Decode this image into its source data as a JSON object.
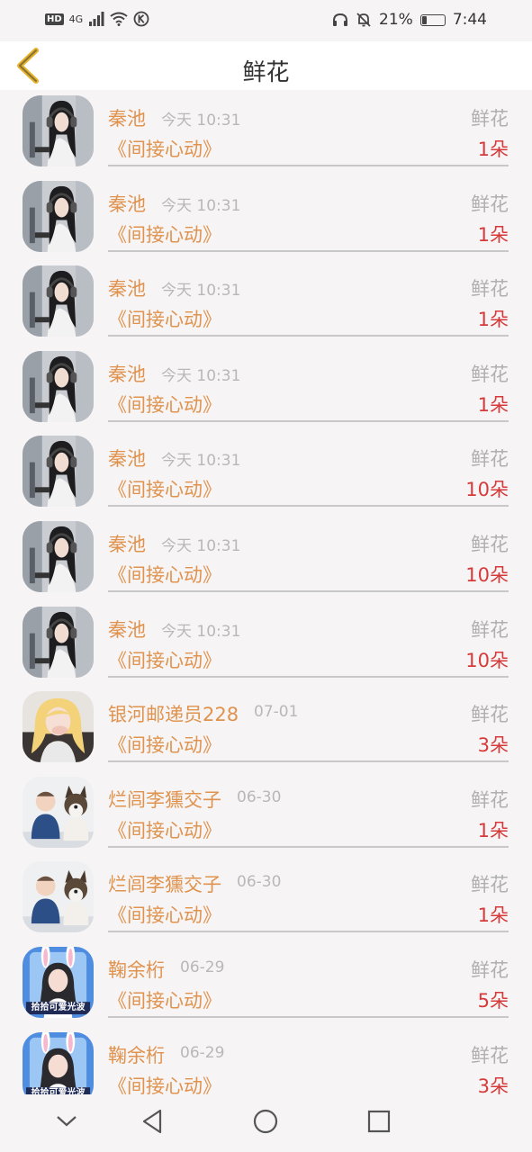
{
  "status_bar": {
    "network_badge": "HD",
    "signal_text": "4G",
    "battery_percent": "21%",
    "battery_level": 0.21,
    "time": "7:44"
  },
  "header": {
    "title": "鲜花"
  },
  "rows": [
    {
      "name": "秦池",
      "time": "今天 10:31",
      "gift": "鲜花",
      "song": "《间接心动》",
      "count": "1朵",
      "avatar": "girl-headphones"
    },
    {
      "name": "秦池",
      "time": "今天 10:31",
      "gift": "鲜花",
      "song": "《间接心动》",
      "count": "1朵",
      "avatar": "girl-headphones"
    },
    {
      "name": "秦池",
      "time": "今天 10:31",
      "gift": "鲜花",
      "song": "《间接心动》",
      "count": "1朵",
      "avatar": "girl-headphones"
    },
    {
      "name": "秦池",
      "time": "今天 10:31",
      "gift": "鲜花",
      "song": "《间接心动》",
      "count": "1朵",
      "avatar": "girl-headphones"
    },
    {
      "name": "秦池",
      "time": "今天 10:31",
      "gift": "鲜花",
      "song": "《间接心动》",
      "count": "10朵",
      "avatar": "girl-headphones"
    },
    {
      "name": "秦池",
      "time": "今天 10:31",
      "gift": "鲜花",
      "song": "《间接心动》",
      "count": "10朵",
      "avatar": "girl-headphones"
    },
    {
      "name": "秦池",
      "time": "今天 10:31",
      "gift": "鲜花",
      "song": "《间接心动》",
      "count": "10朵",
      "avatar": "girl-headphones"
    },
    {
      "name": "银河邮递员228",
      "time": "07-01",
      "gift": "鲜花",
      "song": "《间接心动》",
      "count": "3朵",
      "avatar": "blonde-girl"
    },
    {
      "name": "烂闾李獯交子",
      "time": "06-30",
      "gift": "鲜花",
      "song": "《间接心动》",
      "count": "1朵",
      "avatar": "baby-dog"
    },
    {
      "name": "烂闾李獯交子",
      "time": "06-30",
      "gift": "鲜花",
      "song": "《间接心动》",
      "count": "1朵",
      "avatar": "baby-dog"
    },
    {
      "name": "鞠余桁",
      "time": "06-29",
      "gift": "鲜花",
      "song": "《间接心动》",
      "count": "5朵",
      "avatar": "bunny-girl"
    },
    {
      "name": "鞠余桁",
      "time": "06-29",
      "gift": "鲜花",
      "song": "《间接心动》",
      "count": "3朵",
      "avatar": "bunny-girl"
    }
  ],
  "avatar_caption": "拾拾可爱光波",
  "colors": {
    "accent_name": "#e0934e",
    "count_red": "#d63a3a",
    "back_arrow": "#e5b22a",
    "muted": "#b8b8b8"
  }
}
